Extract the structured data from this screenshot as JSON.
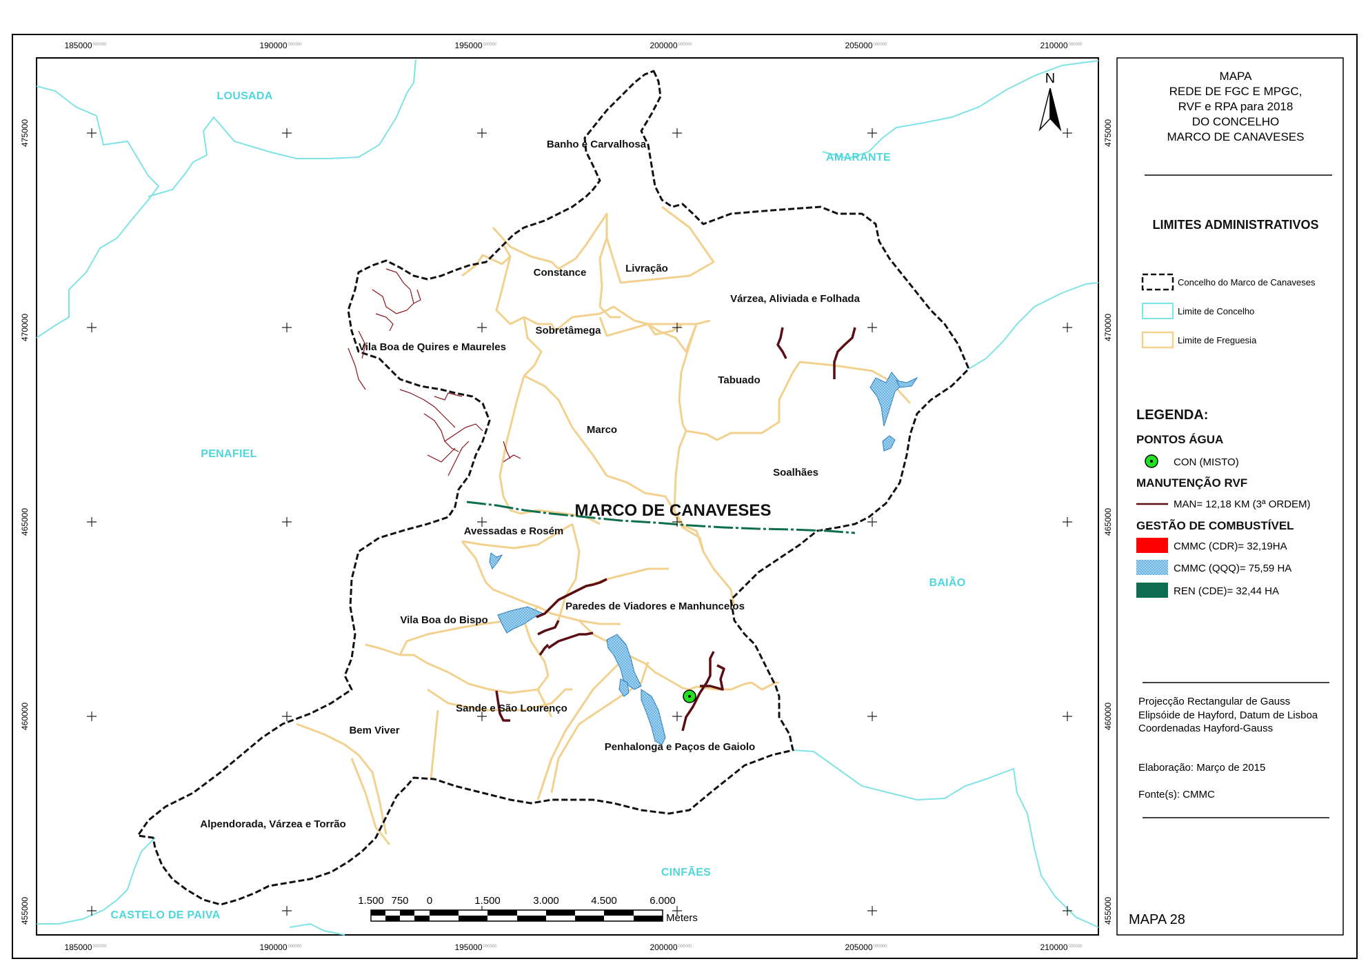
{
  "map": {
    "main_label": "MARCO DE CANAVESES",
    "parishes": [
      {
        "name": "Banho e Carvalhosa"
      },
      {
        "name": "Constance"
      },
      {
        "name": "Livração"
      },
      {
        "name": "Várzea, Aliviada e Folhada"
      },
      {
        "name": "Sobretâmega"
      },
      {
        "name": "Vila Boa de Quires e Maureles"
      },
      {
        "name": "Tabuado"
      },
      {
        "name": "Marco"
      },
      {
        "name": "Soalhães"
      },
      {
        "name": "Avessadas e Rosém"
      },
      {
        "name": "Paredes de Viadores e Manhuncelos"
      },
      {
        "name": "Vila Boa do Bispo"
      },
      {
        "name": "Sande e São Lourenço"
      },
      {
        "name": "Bem Viver"
      },
      {
        "name": "Penhalonga e Paços de Gaiolo"
      },
      {
        "name": "Alpendorada, Várzea e Torrão"
      }
    ],
    "neighbours": [
      {
        "name": "LOUSADA"
      },
      {
        "name": "AMARANTE"
      },
      {
        "name": "PENAFIEL"
      },
      {
        "name": "BAIÃO"
      },
      {
        "name": "CINFÃES"
      },
      {
        "name": "CASTELO DE PAIVA"
      }
    ],
    "north_label": "N",
    "x_ticks": [
      "185000",
      "190000",
      "195000",
      "200000",
      "205000",
      "210000"
    ],
    "y_ticks": [
      "475000",
      "470000",
      "465000",
      "460000",
      "455000"
    ],
    "tick_suffix": "000000",
    "scale_bar": {
      "labels": [
        "1.500",
        "750",
        "0",
        "1.500",
        "3.000",
        "4.500",
        "6.000"
      ],
      "unit": "Meters"
    }
  },
  "panel": {
    "title_lines": [
      "MAPA",
      "REDE DE FGC E MPGC,",
      "RVF e RPA para 2018",
      "DO CONCELHO",
      "MARCO DE CANAVESES"
    ],
    "admin_heading": "LIMITES ADMINISTRATIVOS",
    "admin_items": [
      {
        "label": "Concelho do Marco de Canaveses"
      },
      {
        "label": "Limite de Concelho"
      },
      {
        "label": "Limite de Freguesia"
      }
    ],
    "legend_heading": "LEGENDA:",
    "water_heading": "PONTOS ÁGUA",
    "water_item": "CON (MISTO)",
    "rvf_heading": "MANUTENÇÃO RVF",
    "rvf_item": "MAN= 12,18 KM (3ª ORDEM)",
    "fuel_heading": "GESTÃO DE COMBUSTÍVEL",
    "fuel_items": [
      {
        "label": "CMMC (CDR)= 32,19HA",
        "color": "#ff0000"
      },
      {
        "label": "CMMC (QQQ)= 75,59 HA",
        "color": "#9fd3f2"
      },
      {
        "label": "REN (CDE)= 32,44 HA",
        "color": "#0c6e4f"
      }
    ],
    "projection_lines": [
      "Projecção Rectangular de Gauss",
      "Elipsóide de Hayford, Datum de Lisboa",
      "Coordenadas Hayford-Gauss"
    ],
    "elaboration": "Elaboração: Março de 2015",
    "source": "Fonte(s): CMMC",
    "map_number": "MAPA 28"
  },
  "colors": {
    "concelho_border": "#111111",
    "neighbour_border": "#7fe3e6",
    "parish_border": "#f2d18f",
    "rvf": "#5a0d12",
    "water_point": "#22e022"
  }
}
